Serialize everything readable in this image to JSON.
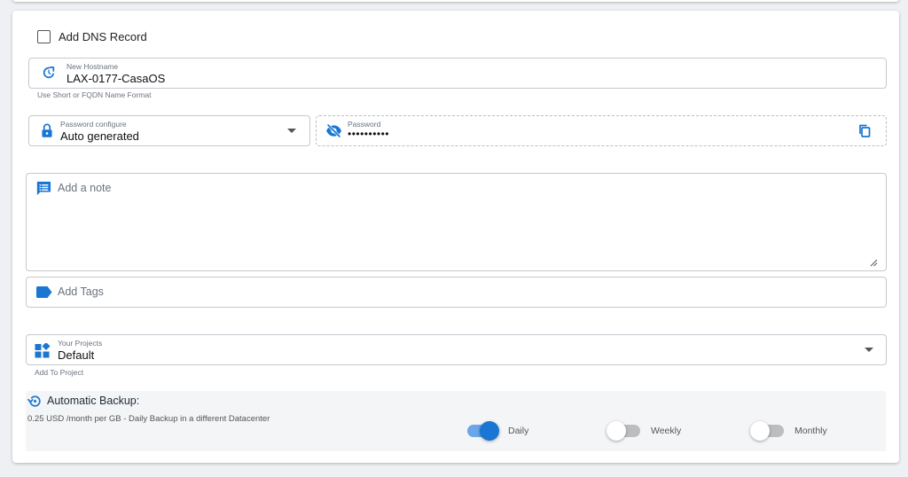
{
  "dns": {
    "label": "Add DNS Record",
    "checked": false
  },
  "hostname": {
    "label": "New Hostname",
    "value": "LAX-0177-CasaOS",
    "helper": "Use Short or FQDN Name Format",
    "icon": "refresh-icon"
  },
  "password_config": {
    "label": "Password configure",
    "value": "Auto generated",
    "icon": "lock-icon"
  },
  "password": {
    "label": "Password",
    "value": "••••••••••",
    "icon": "eye-off-icon",
    "copy_icon": "copy-icon"
  },
  "note": {
    "placeholder": "Add a note",
    "icon": "note-icon"
  },
  "tags": {
    "placeholder": "Add Tags",
    "icon": "tag-icon"
  },
  "projects": {
    "label": "Your Projects",
    "value": "Default",
    "helper": "Add To Project",
    "icon": "projects-icon"
  },
  "backup": {
    "title": "Automatic Backup:",
    "description": "0.25 USD /month per GB - Daily Backup in a different Datacenter",
    "options": [
      {
        "label": "Daily",
        "on": true
      },
      {
        "label": "Weekly",
        "on": false
      },
      {
        "label": "Monthly",
        "on": false
      }
    ]
  },
  "colors": {
    "accent": "#1976d2",
    "border": "#c5c9ce",
    "panel": "#f4f5f7"
  }
}
